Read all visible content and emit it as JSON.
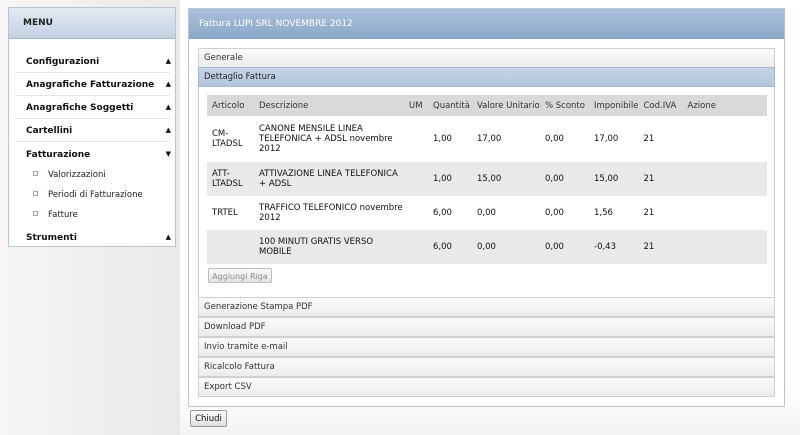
{
  "menu": {
    "title": "MENU",
    "sections": [
      {
        "label": "Configurazioni",
        "expanded": false
      },
      {
        "label": "Anagrafiche Fatturazione",
        "expanded": false
      },
      {
        "label": "Anagrafiche Soggetti",
        "expanded": false
      },
      {
        "label": "Cartellini",
        "expanded": false
      },
      {
        "label": "Fatturazione",
        "expanded": true
      },
      {
        "label": "Strumenti",
        "expanded": false
      }
    ],
    "fatturazione_items": [
      "Valorizzazioni",
      "Periodi di Fatturazione",
      "Fatture"
    ]
  },
  "panel": {
    "title": "Fattura LUPI SRL NOVEMBRE 2012",
    "sections": {
      "generale": "Generale",
      "dettaglio": "Dettaglio Fattura",
      "stampa": "Generazione Stampa PDF",
      "download": "Download PDF",
      "email": "Invio tramite e-mail",
      "ricalcolo": "Ricalcolo Fattura",
      "export": "Export CSV"
    }
  },
  "table": {
    "columns": [
      "Articolo",
      "Descrizione",
      "UM",
      "Quantità",
      "Valore Unitario",
      "% Sconto",
      "Imponibile",
      "Cod.IVA",
      "Azione"
    ],
    "rows": [
      {
        "articolo": "CM-LTADSL",
        "descrizione": "CANONE MENSILE LINEA TELEFONICA + ADSL novembre 2012",
        "um": "",
        "quantita": "1,00",
        "valore": "17,00",
        "sconto": "0,00",
        "imponibile": "17,00",
        "iva": "21",
        "azione": ""
      },
      {
        "articolo": "ATT-LTADSL",
        "descrizione": "ATTIVAZIONE LINEA TELEFONICA + ADSL",
        "um": "",
        "quantita": "1,00",
        "valore": "15,00",
        "sconto": "0,00",
        "imponibile": "15,00",
        "iva": "21",
        "azione": ""
      },
      {
        "articolo": "TRTEL",
        "descrizione": "TRAFFICO TELEFONICO novembre 2012",
        "um": "",
        "quantita": "6,00",
        "valore": "0,00",
        "sconto": "0,00",
        "imponibile": "1,56",
        "iva": "21",
        "azione": ""
      },
      {
        "articolo": "",
        "descrizione": "100 MINUTI GRATIS VERSO MOBILE",
        "um": "",
        "quantita": "6,00",
        "valore": "0,00",
        "sconto": "0,00",
        "imponibile": "-0,43",
        "iva": "21",
        "azione": ""
      }
    ]
  },
  "buttons": {
    "add_row": "Aggiungi Riga",
    "close": "Chiudi"
  }
}
